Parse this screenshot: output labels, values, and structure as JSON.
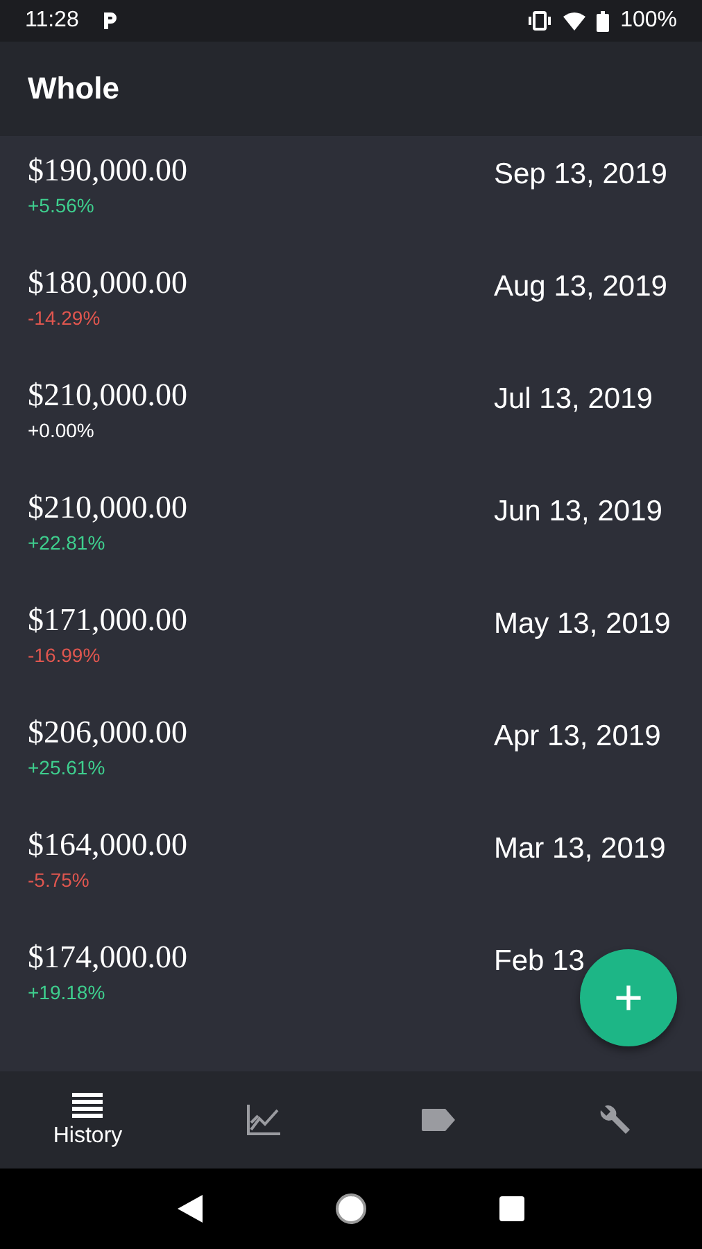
{
  "status_bar": {
    "time": "11:28",
    "battery": "100%"
  },
  "app_bar": {
    "title": "Whole"
  },
  "entries": [
    {
      "amount": "$190,000.00",
      "change": "+5.56%",
      "color": "#3ecf8e",
      "date": "Sep 13, 2019"
    },
    {
      "amount": "$180,000.00",
      "change": "-14.29%",
      "color": "#e0564f",
      "date": "Aug 13, 2019"
    },
    {
      "amount": "$210,000.00",
      "change": "+0.00%",
      "color": "#ffffff",
      "date": "Jul 13, 2019"
    },
    {
      "amount": "$210,000.00",
      "change": "+22.81%",
      "color": "#3ecf8e",
      "date": "Jun 13, 2019"
    },
    {
      "amount": "$171,000.00",
      "change": "-16.99%",
      "color": "#e0564f",
      "date": "May 13, 2019"
    },
    {
      "amount": "$206,000.00",
      "change": "+25.61%",
      "color": "#3ecf8e",
      "date": "Apr 13, 2019"
    },
    {
      "amount": "$164,000.00",
      "change": "-5.75%",
      "color": "#e0564f",
      "date": "Mar 13, 2019"
    },
    {
      "amount": "$174,000.00",
      "change": "+19.18%",
      "color": "#3ecf8e",
      "date": "Feb 13"
    }
  ],
  "fab": {
    "label": "+"
  },
  "bottom_nav": [
    {
      "label": "History",
      "selected": true
    },
    {
      "selected": false
    },
    {
      "selected": false
    },
    {
      "selected": false
    }
  ]
}
